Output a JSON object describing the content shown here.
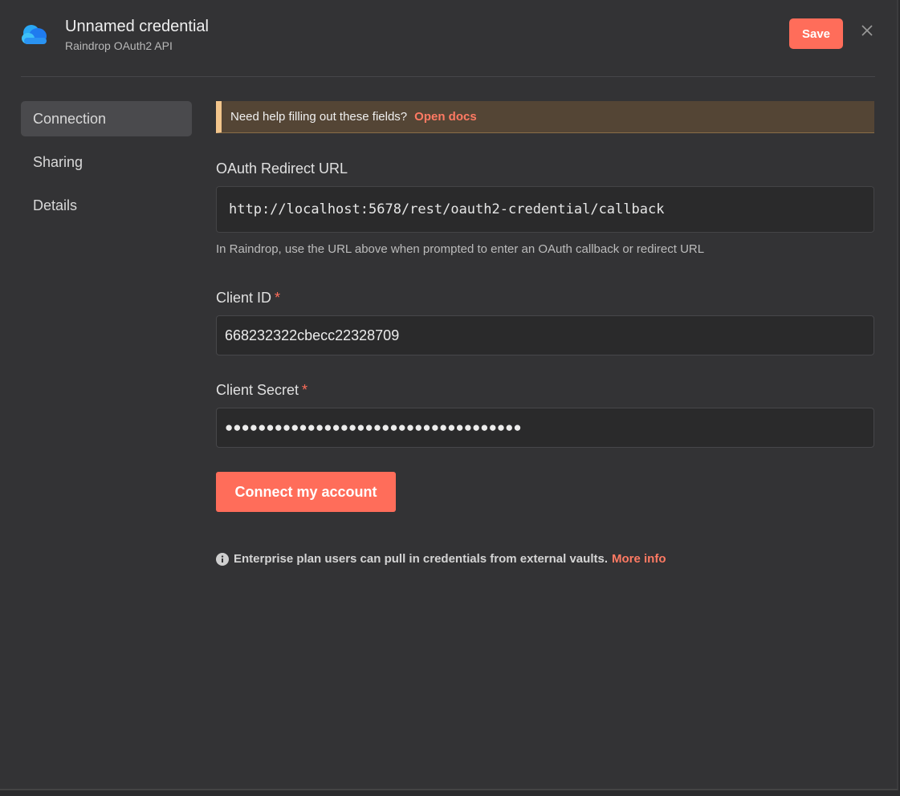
{
  "header": {
    "title": "Unnamed credential",
    "subtitle": "Raindrop OAuth2 API",
    "save_label": "Save",
    "logo_icon": "raindrop-cloud-icon",
    "close_icon": "close-icon"
  },
  "sidebar": {
    "items": [
      {
        "label": "Connection",
        "active": true
      },
      {
        "label": "Sharing",
        "active": false
      },
      {
        "label": "Details",
        "active": false
      }
    ]
  },
  "help": {
    "text": "Need help filling out these fields?",
    "link": "Open docs"
  },
  "redirect": {
    "label": "OAuth Redirect URL",
    "value": "http://localhost:5678/rest/oauth2-credential/callback",
    "hint": "In Raindrop, use the URL above when prompted to enter an OAuth callback or redirect URL"
  },
  "client_id": {
    "label": "Client ID",
    "required_mark": "*",
    "value": "668232322cbecc22328709"
  },
  "client_secret": {
    "label": "Client Secret",
    "required_mark": "*",
    "value": "●●●●●●●●●●●●●●●●●●●●●●●●●●●●●●●●●●●●"
  },
  "connect_label": "Connect my account",
  "enterprise": {
    "icon": "info-icon",
    "text": "Enterprise plan users can pull in credentials from external vaults.",
    "link": "More info"
  },
  "colors": {
    "accent": "#ff6d5a",
    "background": "#333335",
    "help_bg": "#544535",
    "help_border": "#f2c58c"
  }
}
